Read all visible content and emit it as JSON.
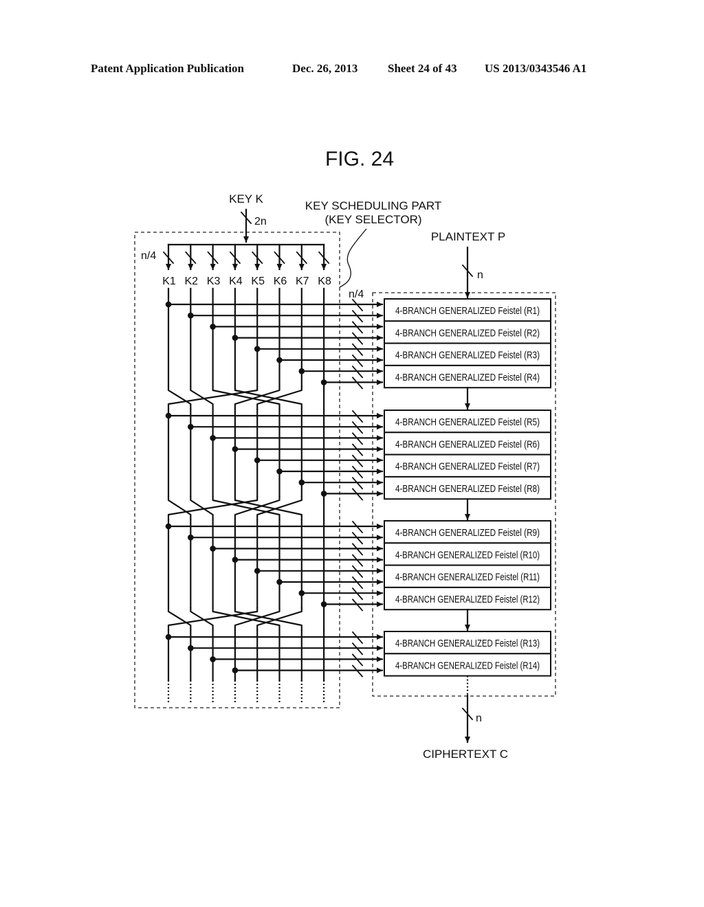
{
  "header": {
    "publication": "Patent Application Publication",
    "date": "Dec. 26, 2013",
    "sheet": "Sheet 24 of 43",
    "number": "US 2013/0343546 A1"
  },
  "figure": {
    "title": "FIG. 24",
    "key_input": {
      "label": "KEY K",
      "width": "2n"
    },
    "key_part": {
      "label_line1": "KEY SCHEDULING PART",
      "label_line2": "(KEY SELECTOR)"
    },
    "split_width": "n/4",
    "bus_width": "n/4",
    "round_keys": [
      "K1",
      "K2",
      "K3",
      "K4",
      "K5",
      "K6",
      "K7",
      "K8"
    ],
    "plaintext": {
      "label": "PLAINTEXT P",
      "width": "n"
    },
    "ciphertext": {
      "label": "CIPHERTEXT C",
      "width": "n"
    },
    "round_groups": [
      [
        "4-BRANCH GENERALIZED Feistel (R1)",
        "4-BRANCH GENERALIZED Feistel (R2)",
        "4-BRANCH GENERALIZED Feistel (R3)",
        "4-BRANCH GENERALIZED Feistel (R4)"
      ],
      [
        "4-BRANCH GENERALIZED Feistel (R5)",
        "4-BRANCH GENERALIZED Feistel (R6)",
        "4-BRANCH GENERALIZED Feistel (R7)",
        "4-BRANCH GENERALIZED Feistel (R8)"
      ],
      [
        "4-BRANCH GENERALIZED Feistel (R9)",
        "4-BRANCH GENERALIZED Feistel (R10)",
        "4-BRANCH GENERALIZED Feistel (R11)",
        "4-BRANCH GENERALIZED Feistel (R12)"
      ],
      [
        "4-BRANCH GENERALIZED Feistel (R13)",
        "4-BRANCH GENERALIZED Feistel (R14)"
      ]
    ],
    "key_permutation": {
      "description": "between round groups, key line at top column i continues to bottom column perm[i]",
      "perm": [
        2,
        3,
        6,
        7,
        1,
        4,
        5,
        8
      ]
    }
  }
}
